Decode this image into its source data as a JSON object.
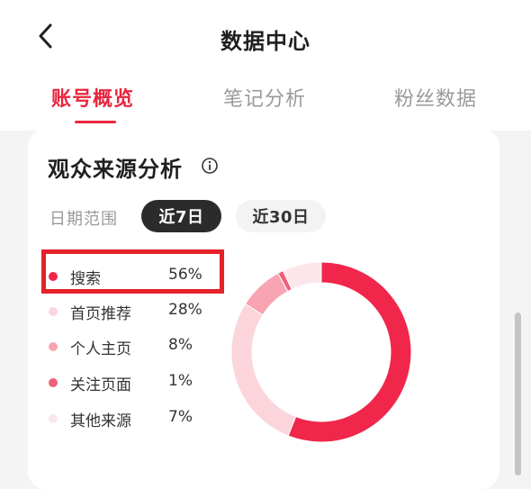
{
  "header": {
    "title": "数据中心",
    "back_icon": "chevron-left-icon"
  },
  "tabs": [
    {
      "label": "账号概览",
      "active": true
    },
    {
      "label": "笔记分析",
      "active": false
    },
    {
      "label": "粉丝数据",
      "active": false
    }
  ],
  "card": {
    "title": "观众来源分析",
    "info_icon": "info-icon",
    "date_range_label": "日期范围",
    "date_options": [
      {
        "label": "近7日",
        "selected": true
      },
      {
        "label": "近30日",
        "selected": false
      }
    ],
    "legend": [
      {
        "label": "搜索",
        "value": "56%",
        "percent": 56,
        "color": "#f0264a"
      },
      {
        "label": "首页推荐",
        "value": "28%",
        "percent": 28,
        "color": "#fcd5dc"
      },
      {
        "label": "个人主页",
        "value": "8%",
        "percent": 8,
        "color": "#f8a4b3"
      },
      {
        "label": "关注页面",
        "value": "1%",
        "percent": 1,
        "color": "#ef5f79"
      },
      {
        "label": "其他来源",
        "value": "7%",
        "percent": 7,
        "color": "#fde6ea"
      }
    ]
  },
  "colors": {
    "accent": "#e8263f",
    "highlight_border": "#e5222a",
    "selected_pill": "#2b2b2b"
  }
}
